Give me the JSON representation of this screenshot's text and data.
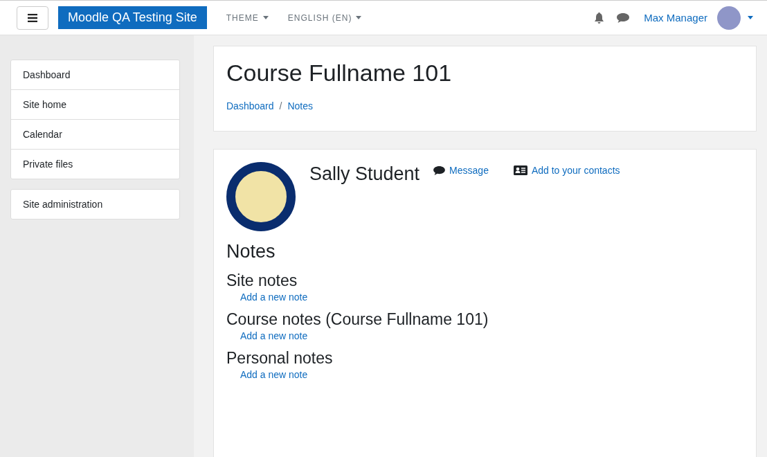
{
  "navbar": {
    "site_name": "Moodle QA Testing Site",
    "menus": [
      {
        "label": "THEME"
      },
      {
        "label": "ENGLISH (EN)"
      }
    ],
    "user_name": "Max Manager"
  },
  "sidebar": {
    "groups": [
      {
        "items": [
          {
            "label": "Dashboard"
          },
          {
            "label": "Site home"
          },
          {
            "label": "Calendar"
          },
          {
            "label": "Private files"
          }
        ]
      },
      {
        "items": [
          {
            "label": "Site administration"
          }
        ]
      }
    ]
  },
  "header": {
    "title": "Course Fullname 101",
    "breadcrumb": [
      {
        "label": "Dashboard"
      },
      {
        "label": "Notes"
      }
    ],
    "separator": "/"
  },
  "profile": {
    "name": "Sally Student",
    "actions": [
      {
        "kind": "message",
        "label": "Message"
      },
      {
        "kind": "contact",
        "label": "Add to your contacts"
      }
    ]
  },
  "notes": {
    "heading": "Notes",
    "sections": [
      {
        "title": "Site notes",
        "link": "Add a new note"
      },
      {
        "title": "Course notes (Course Fullname 101)",
        "link": "Add a new note"
      },
      {
        "title": "Personal notes",
        "link": "Add a new note"
      }
    ]
  }
}
